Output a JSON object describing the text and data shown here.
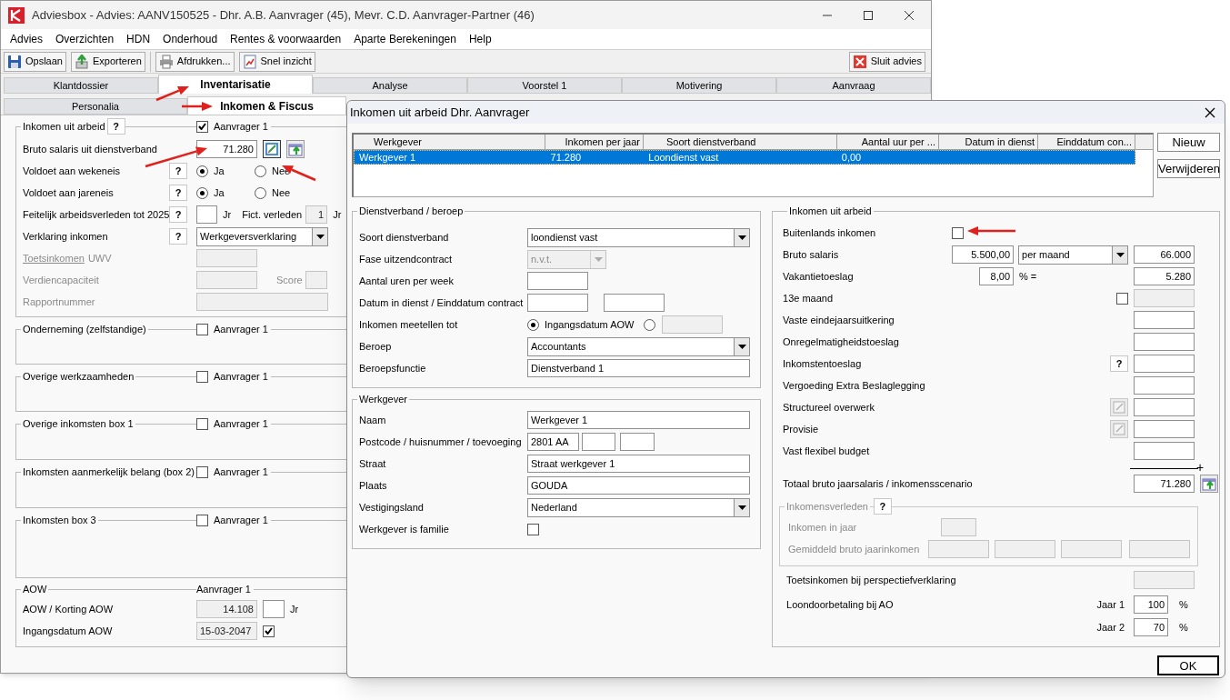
{
  "window": {
    "title": "Adviesbox - Advies: AANV150525 - Dhr. A.B. Aanvrager (45), Mevr. C.D. Aanvrager-Partner (46)"
  },
  "menu": [
    "Advies",
    "Overzichten",
    "HDN",
    "Onderhoud",
    "Rentes & voorwaarden",
    "Aparte Berekeningen",
    "Help"
  ],
  "toolbar": [
    {
      "label": "Opslaan",
      "kind": "save"
    },
    {
      "label": "Exporteren",
      "kind": "export"
    },
    {
      "label": "Afdrukken...",
      "kind": "print"
    },
    {
      "label": "Snel inzicht",
      "kind": "report"
    }
  ],
  "close_advice_button": "Sluit advies",
  "main_tabs": [
    {
      "label": "Klantdossier",
      "selected": false
    },
    {
      "label": "Inventarisatie",
      "selected": true
    },
    {
      "label": "Analyse",
      "selected": false
    },
    {
      "label": "Voorstel 1",
      "selected": false
    },
    {
      "label": "Motivering",
      "selected": false
    },
    {
      "label": "Aanvraag",
      "selected": false
    }
  ],
  "sub_tabs": [
    {
      "label": "Personalia",
      "selected": false
    },
    {
      "label": "Inkomen & Fiscus",
      "selected": true
    }
  ],
  "employment_income": {
    "legend": "Inkomen uit arbeid",
    "help": "?",
    "applicant": {
      "label": "Aanvrager 1",
      "checked": true
    },
    "gross_salary": {
      "label": "Bruto salaris uit dienstverband",
      "value": "71.280"
    },
    "tests": [
      {
        "label": "Voldoet aan wekeneis",
        "help": "?",
        "options": [
          {
            "label": "Ja",
            "selected": true
          },
          {
            "label": "Nee",
            "selected": false
          }
        ]
      },
      {
        "label": "Voldoet aan jareneis",
        "help": "?",
        "options": [
          {
            "label": "Ja",
            "selected": true
          },
          {
            "label": "Nee",
            "selected": false
          }
        ]
      }
    ],
    "work_history": {
      "label": "Feitelijk arbeidsverleden tot 2025",
      "help": "?",
      "unit": "Jr",
      "fictive_label": "Fict. verleden",
      "fictive_value": "1",
      "fictive_unit": "Jr"
    },
    "statement": {
      "label": "Verklaring inkomen",
      "help": "?",
      "value": "Werkgeversverklaring"
    },
    "test_income": {
      "label": "Toetsinkomen",
      "suffix": "UWV",
      "disabled": true
    },
    "earning_capacity": {
      "label": "Verdiencapaciteit",
      "score_label": "Score",
      "disabled": true
    },
    "report_number": {
      "label": "Rapportnummer",
      "disabled": true
    }
  },
  "income_groups": [
    {
      "legend": "Onderneming (zelfstandige)",
      "applicant": {
        "label": "Aanvrager 1",
        "checked": false
      }
    },
    {
      "legend": "Overige werkzaamheden",
      "applicant": {
        "label": "Aanvrager 1",
        "checked": false
      }
    },
    {
      "legend": "Overige inkomsten box 1",
      "applicant": {
        "label": "Aanvrager 1",
        "checked": false
      }
    },
    {
      "legend": "Inkomsten aanmerkelijk belang (box 2)",
      "applicant": {
        "label": "Aanvrager 1",
        "checked": false
      }
    },
    {
      "legend": "Inkomsten box 3",
      "applicant": {
        "label": "Aanvrager 1",
        "checked": false
      }
    }
  ],
  "aow": {
    "legend": "AOW",
    "column": "Aanvrager 1",
    "discount": {
      "label": "AOW / Korting AOW",
      "value": "14.108",
      "unit": "Jr"
    },
    "start": {
      "label": "Ingangsdatum AOW",
      "value": "15-03-2047",
      "checked": true
    }
  },
  "dialog": {
    "title": "Inkomen uit arbeid Dhr. Aanvrager",
    "table": {
      "columns": [
        "Werkgever",
        "Inkomen per jaar",
        "Soort dienstverband",
        "Aantal uur per ...",
        "Datum in dienst",
        "Einddatum con..."
      ],
      "rows": [
        {
          "cells": [
            "Werkgever 1",
            "71.280",
            "Loondienst vast",
            "0,00"
          ],
          "selected": true
        }
      ]
    },
    "buttons": [
      "Nieuw",
      "Verwijderen"
    ],
    "employment": {
      "legend": "Dienstverband / beroep",
      "rows": [
        {
          "kind": "select",
          "label": "Soort dienstverband",
          "value": "loondienst vast"
        },
        {
          "kind": "select",
          "label": "Fase uitzendcontract",
          "value": "n.v.t.",
          "disabled": true
        },
        {
          "kind": "input",
          "label": "Aantal uren per week"
        },
        {
          "kind": "two_inputs",
          "label": "Datum in dienst / Einddatum contract"
        },
        {
          "kind": "radio_pair",
          "label": "Inkomen meetellen tot",
          "options": [
            {
              "label": "Ingangsdatum AOW",
              "selected": true
            },
            {
              "selected": false
            }
          ]
        },
        {
          "kind": "select",
          "label": "Beroep",
          "value": "Accountants"
        },
        {
          "kind": "input",
          "label": "Beroepsfunctie",
          "value": "Dienstverband 1"
        }
      ]
    },
    "employer": {
      "legend": "Werkgever",
      "rows": [
        {
          "kind": "input",
          "label": "Naam",
          "value": "Werkgever 1"
        },
        {
          "kind": "postcode",
          "label": "Postcode / huisnummer / toevoeging",
          "value": "2801 AA"
        },
        {
          "kind": "input",
          "label": "Straat",
          "value": "Straat werkgever 1"
        },
        {
          "kind": "input",
          "label": "Plaats",
          "value": "GOUDA"
        },
        {
          "kind": "select",
          "label": "Vestigingsland",
          "value": "Nederland"
        },
        {
          "kind": "checkbox",
          "label": "Werkgever is familie",
          "checked": false
        }
      ]
    },
    "income": {
      "legend": "Inkomen uit arbeid",
      "rows": [
        {
          "kind": "checkbox",
          "label": "Buitenlands inkomen",
          "checked": false
        },
        {
          "kind": "salary",
          "label": "Bruto salaris",
          "amount": "5.500,00",
          "period": "per maand",
          "total": "66.000"
        },
        {
          "kind": "percent",
          "label": "Vakantietoeslag",
          "percent": "8,00",
          "unit": "% =",
          "total": "5.280"
        },
        {
          "kind": "checkbox_amount",
          "label": "13e maand",
          "checked": false
        },
        {
          "kind": "amount",
          "label": "Vaste eindejaarsuitkering"
        },
        {
          "kind": "amount",
          "label": "Onregelmatigheidstoeslag"
        },
        {
          "kind": "help_amount",
          "label": "Inkomstentoeslag",
          "help": "?"
        },
        {
          "kind": "amount",
          "label": "Vergoeding Extra Beslaglegging"
        },
        {
          "kind": "edit_amount",
          "label": "Structureel overwerk"
        },
        {
          "kind": "edit_amount",
          "label": "Provisie"
        },
        {
          "kind": "amount",
          "label": "Vast flexibel budget"
        }
      ],
      "sum_sign": "+",
      "total": {
        "label": "Totaal bruto jaarsalaris / inkomensscenario",
        "value": "71.280"
      },
      "history": {
        "legend": "Inkomensverleden",
        "help": "?",
        "year_label": "Inkomen in jaar",
        "average_label": "Gemiddeld bruto jaarinkomen"
      },
      "perspective": {
        "label": "Toetsinkomen bij perspectiefverklaring"
      },
      "continued_pay": {
        "label": "Loondoorbetaling bij AO",
        "years": [
          {
            "label": "Jaar 1",
            "value": "100",
            "unit": "%"
          },
          {
            "label": "Jaar 2",
            "value": "70",
            "unit": "%"
          }
        ]
      }
    },
    "ok_button": "OK"
  }
}
